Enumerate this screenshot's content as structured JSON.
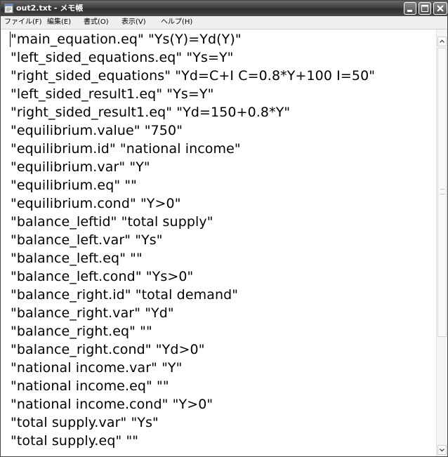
{
  "window": {
    "title": "out2.txt - メモ帳",
    "icon": "notepad-icon",
    "controls": [
      "minimize-icon",
      "maximize-icon",
      "close-icon"
    ]
  },
  "menubar": {
    "items": [
      {
        "label": "ファイル(F)"
      },
      {
        "label": "編集(E)"
      },
      {
        "label": "書式(O)"
      },
      {
        "label": "表示(V)"
      },
      {
        "label": "ヘルプ(H)"
      }
    ]
  },
  "editor": {
    "lines": [
      "\"main_equation.eq\" \"Ys(Y)=Yd(Y)\"",
      "\"left_sided_equations.eq\" \"Ys=Y\"",
      "\"right_sided_equations\" \"Yd=C+I C=0.8*Y+100 I=50\"",
      "\"left_sided_result1.eq\" \"Ys=Y\"",
      "\"right_sided_result1.eq\" \"Yd=150+0.8*Y\"",
      "\"equilibrium.value\" \"750\"",
      "\"equilibrium.id\" \"national income\"",
      "\"equilibrium.var\" \"Y\"",
      "\"equilibrium.eq\" \"\"",
      "\"equilibrium.cond\" \"Y>0\"",
      "\"balance_leftid\" \"total supply\"",
      "\"balance_left.var\" \"Ys\"",
      "\"balance_left.eq\" \"\"",
      "\"balance_left.cond\" \"Ys>0\"",
      "\"balance_right.id\" \"total demand\"",
      "\"balance_right.var\" \"Yd\"",
      "\"balance_right.eq\" \"\"",
      "\"balance_right.cond\" \"Yd>0\"",
      "\"national income.var\" \"Y\"",
      "\"national income.eq\" \"\"",
      "\"national income.cond\" \"Y>0\"",
      "\"total supply.var\" \"Ys\"",
      "\"total supply.eq\" \"\""
    ]
  },
  "scrollbar": {
    "up_icon": "scroll-up-arrow-icon",
    "down_icon": "scroll-down-arrow-icon",
    "position": 0
  }
}
